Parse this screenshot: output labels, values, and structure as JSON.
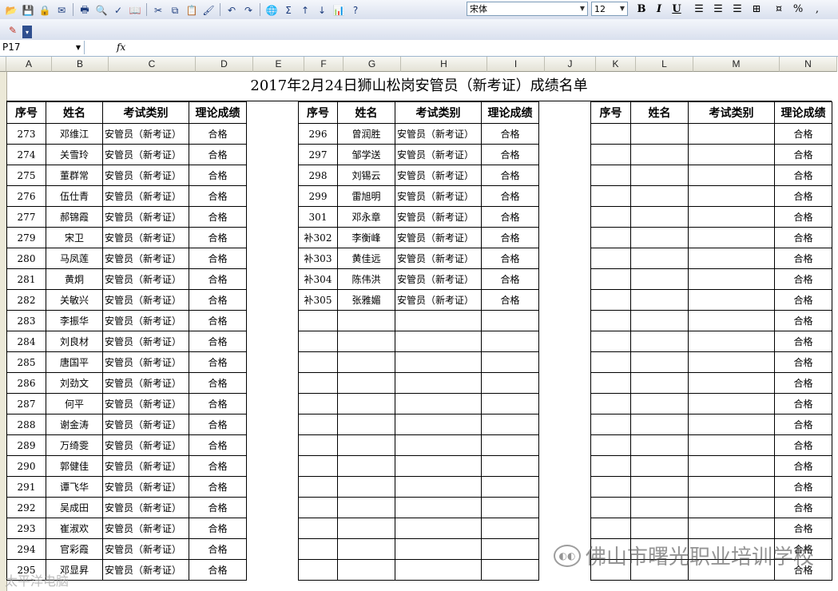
{
  "toolbar": {
    "font_name": "宋体",
    "font_size": "12",
    "bold": "B",
    "italic": "I",
    "underline": "U",
    "percent": "%",
    "comma": ","
  },
  "formula_bar": {
    "name_box": "P17",
    "fx": "fx"
  },
  "columns": [
    "A",
    "B",
    "C",
    "D",
    "E",
    "F",
    "G",
    "H",
    "I",
    "J",
    "K",
    "L",
    "M",
    "N"
  ],
  "sheet": {
    "title": "2017年2月24日狮山松岗安管员（新考证）成绩名单",
    "headers": {
      "seq": "序号",
      "name": "姓名",
      "type": "考试类别",
      "score": "理论成绩"
    },
    "left_rows": [
      {
        "seq": "273",
        "name": "邓维江",
        "type": "安管员（新考证）",
        "score": "合格"
      },
      {
        "seq": "274",
        "name": "关雪玲",
        "type": "安管员（新考证）",
        "score": "合格"
      },
      {
        "seq": "275",
        "name": "董群常",
        "type": "安管员（新考证）",
        "score": "合格"
      },
      {
        "seq": "276",
        "name": "伍仕青",
        "type": "安管员（新考证）",
        "score": "合格"
      },
      {
        "seq": "277",
        "name": "郝锦霞",
        "type": "安管员（新考证）",
        "score": "合格"
      },
      {
        "seq": "279",
        "name": "宋卫",
        "type": "安管员（新考证）",
        "score": "合格"
      },
      {
        "seq": "280",
        "name": "马凤莲",
        "type": "安管员（新考证）",
        "score": "合格"
      },
      {
        "seq": "281",
        "name": "黄炯",
        "type": "安管员（新考证）",
        "score": "合格"
      },
      {
        "seq": "282",
        "name": "关敏兴",
        "type": "安管员（新考证）",
        "score": "合格"
      },
      {
        "seq": "283",
        "name": "李振华",
        "type": "安管员（新考证）",
        "score": "合格"
      },
      {
        "seq": "284",
        "name": "刘良材",
        "type": "安管员（新考证）",
        "score": "合格"
      },
      {
        "seq": "285",
        "name": "唐国平",
        "type": "安管员（新考证）",
        "score": "合格"
      },
      {
        "seq": "286",
        "name": "刘劲文",
        "type": "安管员（新考证）",
        "score": "合格"
      },
      {
        "seq": "287",
        "name": "何平",
        "type": "安管员（新考证）",
        "score": "合格"
      },
      {
        "seq": "288",
        "name": "谢金涛",
        "type": "安管员（新考证）",
        "score": "合格"
      },
      {
        "seq": "289",
        "name": "万绮雯",
        "type": "安管员（新考证）",
        "score": "合格"
      },
      {
        "seq": "290",
        "name": "郭健佳",
        "type": "安管员（新考证）",
        "score": "合格"
      },
      {
        "seq": "291",
        "name": "谭飞华",
        "type": "安管员（新考证）",
        "score": "合格"
      },
      {
        "seq": "292",
        "name": "吴成田",
        "type": "安管员（新考证）",
        "score": "合格"
      },
      {
        "seq": "293",
        "name": "崔淑欢",
        "type": "安管员（新考证）",
        "score": "合格"
      },
      {
        "seq": "294",
        "name": "官彩霞",
        "type": "安管员（新考证）",
        "score": "合格"
      },
      {
        "seq": "295",
        "name": "邓显昇",
        "type": "安管员（新考证）",
        "score": "合格"
      }
    ],
    "middle_rows": [
      {
        "seq": "296",
        "name": "曾润胜",
        "type": "安管员（新考证）",
        "score": "合格"
      },
      {
        "seq": "297",
        "name": "邹学送",
        "type": "安管员（新考证）",
        "score": "合格"
      },
      {
        "seq": "298",
        "name": "刘锡云",
        "type": "安管员（新考证）",
        "score": "合格"
      },
      {
        "seq": "299",
        "name": "雷旭明",
        "type": "安管员（新考证）",
        "score": "合格"
      },
      {
        "seq": "301",
        "name": "邓永章",
        "type": "安管员（新考证）",
        "score": "合格"
      },
      {
        "seq": "补302",
        "name": "李衡峰",
        "type": "安管员（新考证）",
        "score": "合格"
      },
      {
        "seq": "补303",
        "name": "黄佳远",
        "type": "安管员（新考证）",
        "score": "合格"
      },
      {
        "seq": "补304",
        "name": "陈伟洪",
        "type": "安管员（新考证）",
        "score": "合格"
      },
      {
        "seq": "补305",
        "name": "张雅媚",
        "type": "安管员（新考证）",
        "score": "合格"
      },
      {
        "seq": "",
        "name": "",
        "type": "",
        "score": ""
      },
      {
        "seq": "",
        "name": "",
        "type": "",
        "score": ""
      },
      {
        "seq": "",
        "name": "",
        "type": "",
        "score": ""
      },
      {
        "seq": "",
        "name": "",
        "type": "",
        "score": ""
      },
      {
        "seq": "",
        "name": "",
        "type": "",
        "score": ""
      },
      {
        "seq": "",
        "name": "",
        "type": "",
        "score": ""
      },
      {
        "seq": "",
        "name": "",
        "type": "",
        "score": ""
      },
      {
        "seq": "",
        "name": "",
        "type": "",
        "score": ""
      },
      {
        "seq": "",
        "name": "",
        "type": "",
        "score": ""
      },
      {
        "seq": "",
        "name": "",
        "type": "",
        "score": ""
      },
      {
        "seq": "",
        "name": "",
        "type": "",
        "score": ""
      },
      {
        "seq": "",
        "name": "",
        "type": "",
        "score": ""
      },
      {
        "seq": "",
        "name": "",
        "type": "",
        "score": ""
      }
    ],
    "right_rows": [
      {
        "seq": "",
        "name": "",
        "type": "",
        "score": "合格"
      },
      {
        "seq": "",
        "name": "",
        "type": "",
        "score": "合格"
      },
      {
        "seq": "",
        "name": "",
        "type": "",
        "score": "合格"
      },
      {
        "seq": "",
        "name": "",
        "type": "",
        "score": "合格"
      },
      {
        "seq": "",
        "name": "",
        "type": "",
        "score": "合格"
      },
      {
        "seq": "",
        "name": "",
        "type": "",
        "score": "合格"
      },
      {
        "seq": "",
        "name": "",
        "type": "",
        "score": "合格"
      },
      {
        "seq": "",
        "name": "",
        "type": "",
        "score": "合格"
      },
      {
        "seq": "",
        "name": "",
        "type": "",
        "score": "合格"
      },
      {
        "seq": "",
        "name": "",
        "type": "",
        "score": "合格"
      },
      {
        "seq": "",
        "name": "",
        "type": "",
        "score": "合格"
      },
      {
        "seq": "",
        "name": "",
        "type": "",
        "score": "合格"
      },
      {
        "seq": "",
        "name": "",
        "type": "",
        "score": "合格"
      },
      {
        "seq": "",
        "name": "",
        "type": "",
        "score": "合格"
      },
      {
        "seq": "",
        "name": "",
        "type": "",
        "score": "合格"
      },
      {
        "seq": "",
        "name": "",
        "type": "",
        "score": "合格"
      },
      {
        "seq": "",
        "name": "",
        "type": "",
        "score": "合格"
      },
      {
        "seq": "",
        "name": "",
        "type": "",
        "score": "合格"
      },
      {
        "seq": "",
        "name": "",
        "type": "",
        "score": "合格"
      },
      {
        "seq": "",
        "name": "",
        "type": "",
        "score": "合格"
      },
      {
        "seq": "",
        "name": "",
        "type": "",
        "score": "合格"
      },
      {
        "seq": "",
        "name": "",
        "type": "",
        "score": "合格"
      }
    ]
  },
  "watermark": "佛山市曙光职业培训学校",
  "watermark_small": "太平洋电脑"
}
